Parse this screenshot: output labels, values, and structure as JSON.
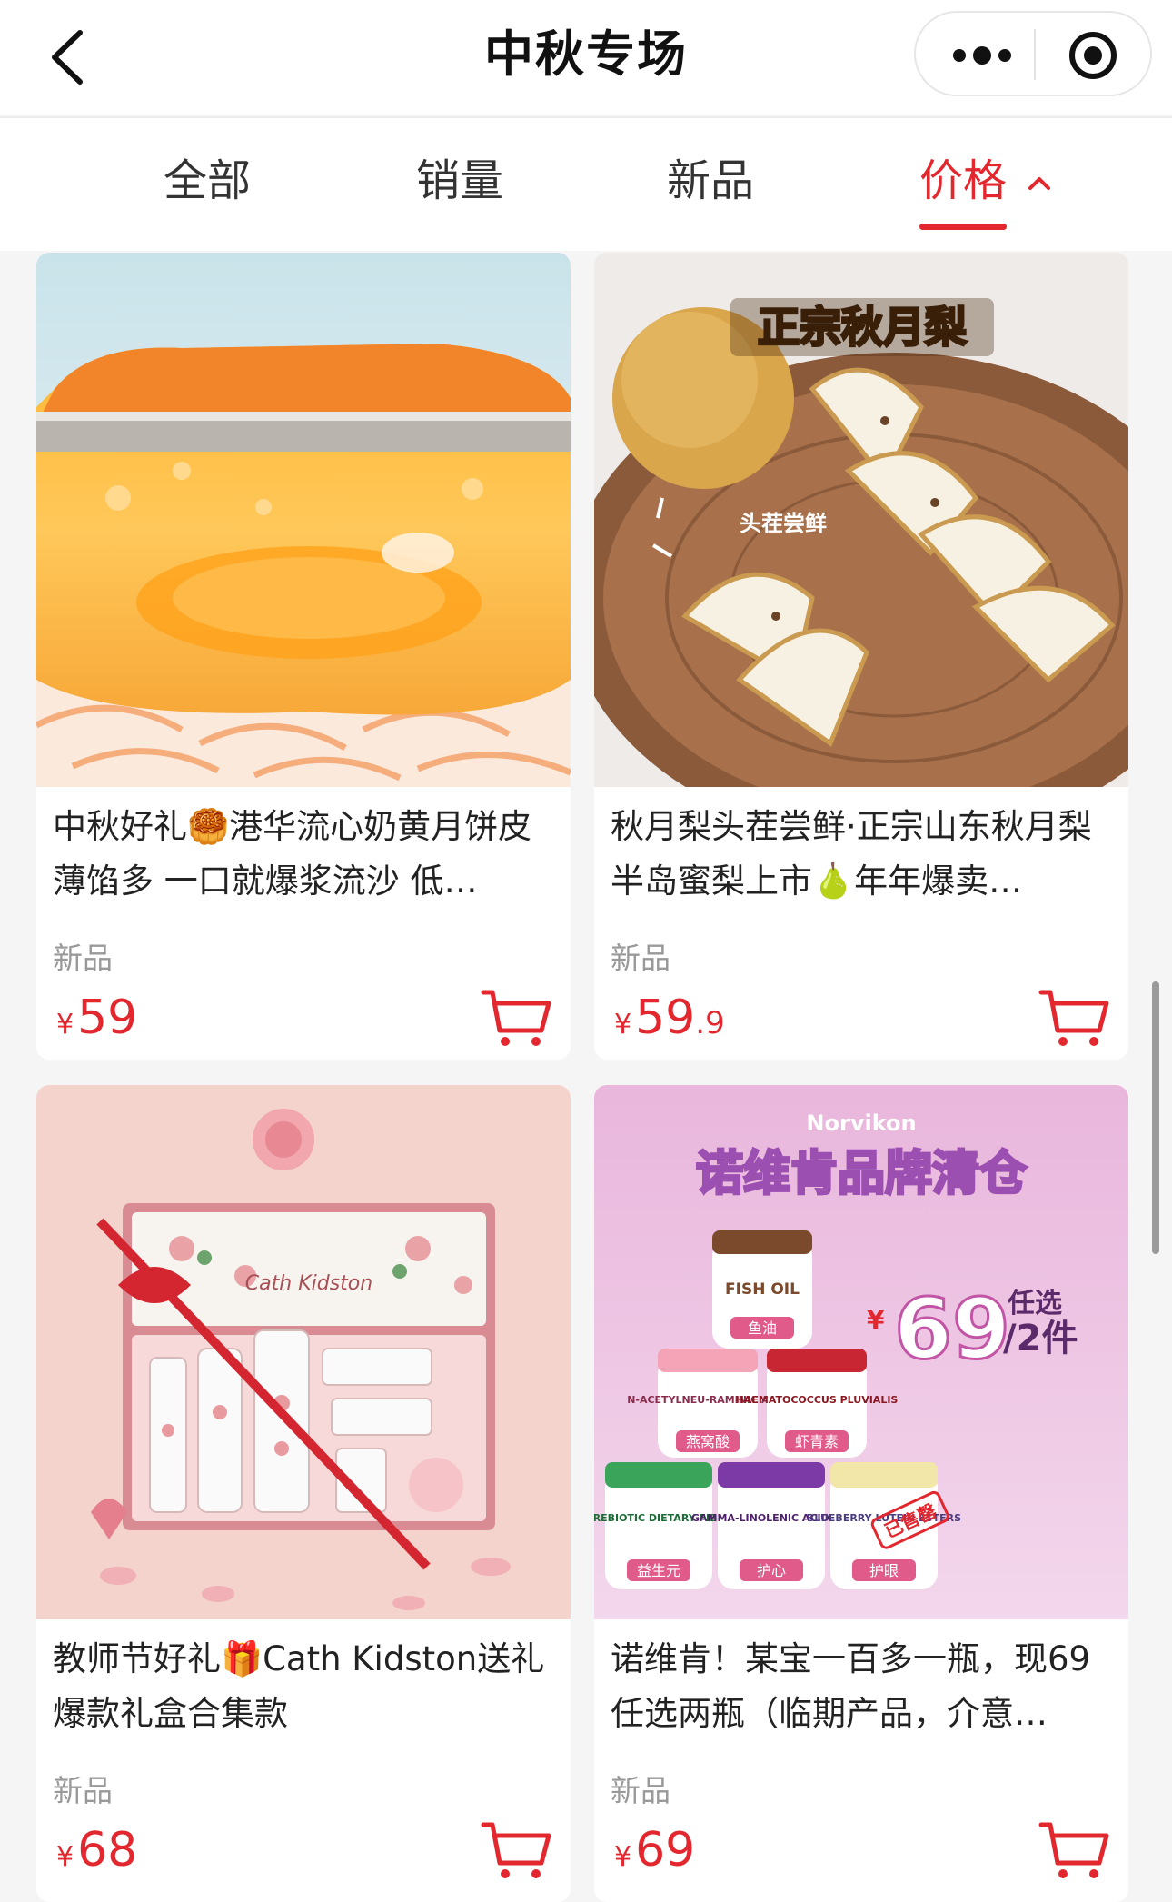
{
  "header": {
    "title": "中秋专场",
    "back_icon": "back-arrow-icon",
    "menu_icon": "more-dots-icon",
    "close_icon": "target-icon"
  },
  "tabs": [
    {
      "label": "全部",
      "active": false
    },
    {
      "label": "销量",
      "active": false
    },
    {
      "label": "新品",
      "active": false
    },
    {
      "label": "价格",
      "active": true,
      "icon": "chevron-up-icon"
    }
  ],
  "accent_color": "#e2282e",
  "products": [
    {
      "title": "中秋好礼🥮港华流心奶黄月饼皮薄馅多 一口就爆浆流沙 低…",
      "tag": "新品",
      "currency": "¥",
      "price_int": "59",
      "price_dec": ""
    },
    {
      "title": "秋月梨头茬尝鲜·正宗山东秋月梨半岛蜜梨上市🍐年年爆卖…",
      "tag": "新品",
      "currency": "¥",
      "price_int": "59",
      "price_dec": ".9",
      "image_text": {
        "banner": "正宗秋月梨",
        "label": "头茬尝鲜"
      }
    },
    {
      "title": "教师节好礼🎁Cath Kidston送礼爆款礼盒合集款",
      "tag": "新品",
      "currency": "¥",
      "price_int": "68",
      "price_dec": "",
      "image_text": {
        "brand": "Cath Kidston"
      }
    },
    {
      "title": "诺维肯！某宝一百多一瓶，现69任选两瓶（临期产品，介意…",
      "tag": "新品",
      "currency": "¥",
      "price_int": "69",
      "price_dec": "",
      "image_text": {
        "brand": "Norvikon",
        "headline": "诺维肯品牌清仓",
        "promo_currency": "¥",
        "promo_price": "69",
        "promo_top": "任选",
        "promo_bottom": "/2件",
        "sold_stamp": "已售罄",
        "jars": [
          {
            "name": "FISH OIL",
            "label": "鱼油"
          },
          {
            "name": "N-ACETYLNEU-RAMINIC ACID",
            "label": "燕窝酸"
          },
          {
            "name": "HAEMATOCOCCUS PLUVIALIS",
            "label": "虾青素"
          },
          {
            "name": "PREBIOTIC DIETARY FIBER",
            "label": "益生元"
          },
          {
            "name": "GAMMA-LINOLENIC ACID OIL",
            "label": "护心"
          },
          {
            "name": "BLUEBERRY LUTEIN ESTERS",
            "label": "护眼"
          }
        ]
      }
    }
  ]
}
